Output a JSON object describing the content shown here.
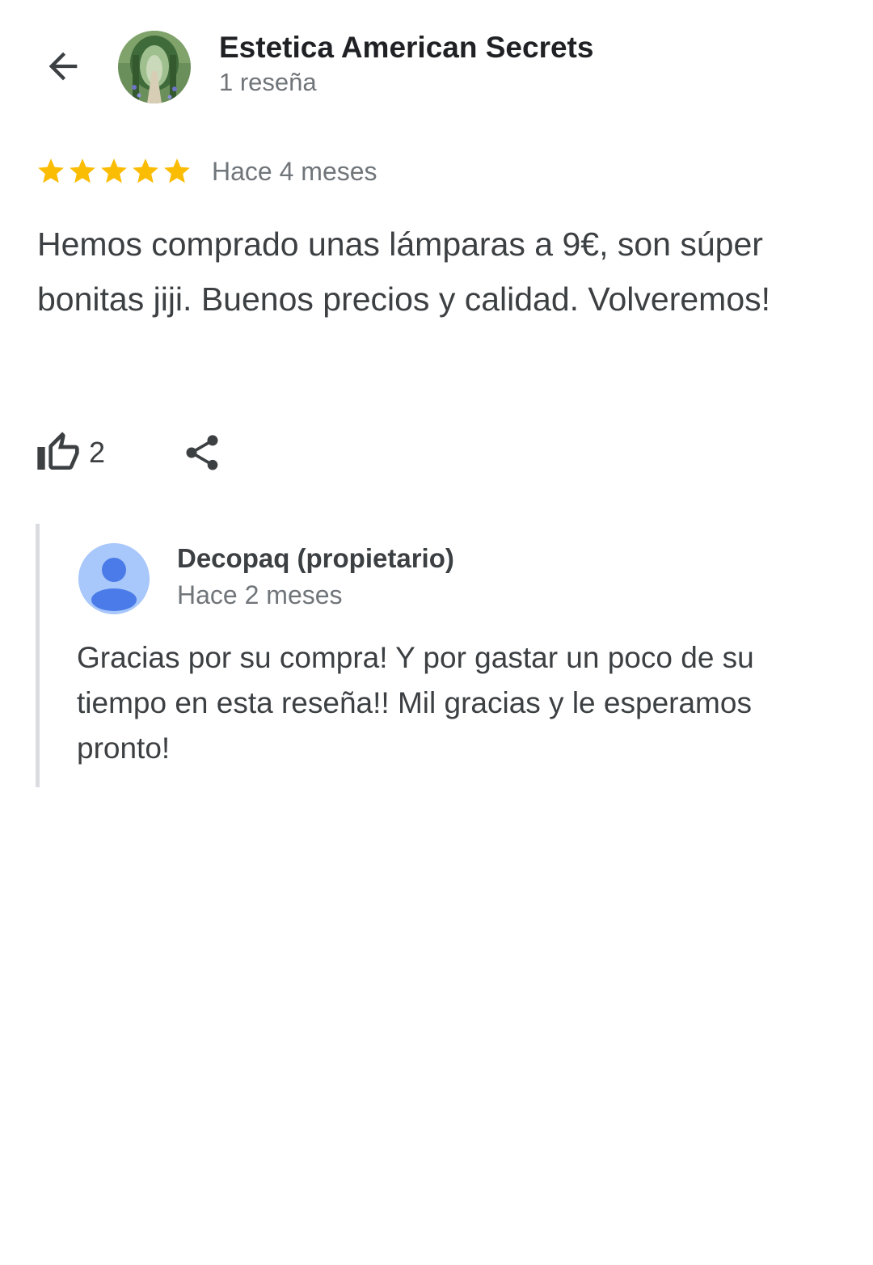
{
  "header": {
    "title": "Estetica American Secrets",
    "subtitle": "1 reseña",
    "back_icon": "arrow-left-icon",
    "avatar": "place-photo-garden-arch"
  },
  "review": {
    "rating": 5,
    "rating_max": 5,
    "star_color": "#fbbc04",
    "time": "Hace 4 meses",
    "text": "Hemos comprado unas lámparas a 9€, son súper bonitas jiji. Buenos precios y calidad. Volveremos!",
    "likes": "2",
    "like_icon": "thumb-up-icon",
    "share_icon": "share-icon"
  },
  "owner_reply": {
    "name": "Decopaq (propietario)",
    "time": "Hace 2 meses",
    "text": "Gracias por su compra! Y por gastar un poco de su tiempo en esta reseña!! Mil gracias y le esperamos pronto!",
    "avatar_icon": "default-person-avatar-icon",
    "avatar_bg": "#a8c7fa",
    "avatar_fg": "#4285f4"
  },
  "colors": {
    "primary_text": "#202124",
    "body_text": "#3c4043",
    "secondary_text": "#70757a",
    "divider": "#dadce0"
  }
}
